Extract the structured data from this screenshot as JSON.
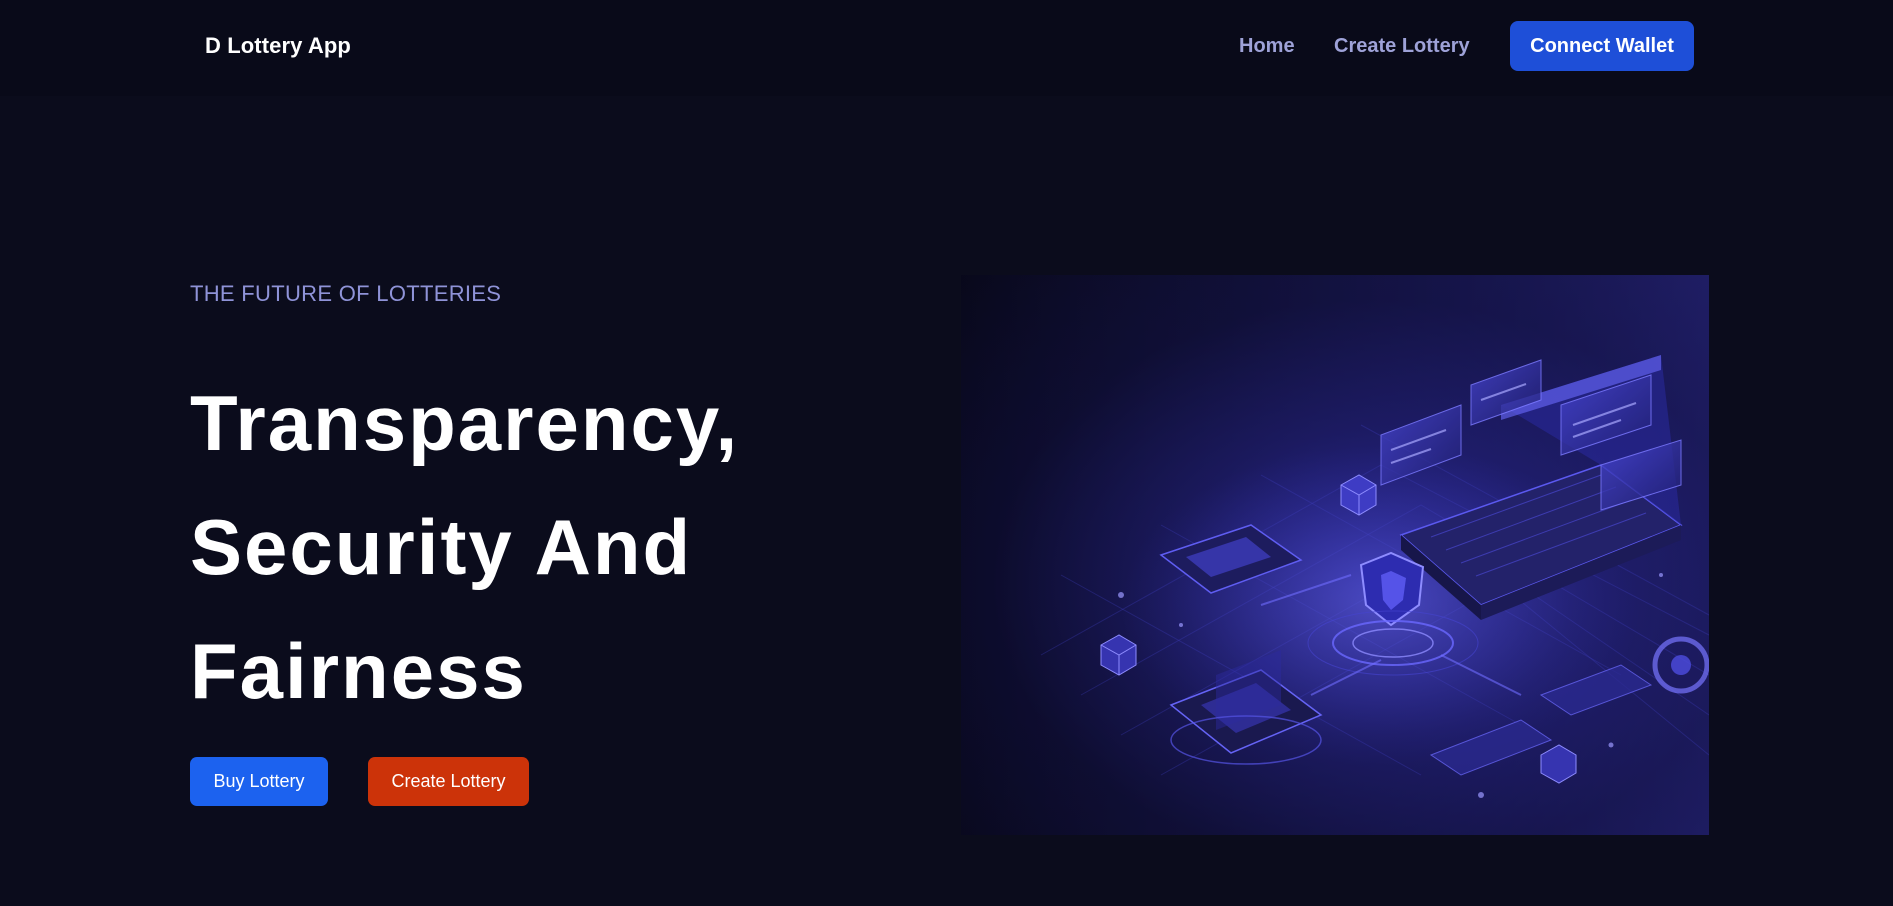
{
  "navbar": {
    "brand": "D Lottery App",
    "links": [
      {
        "label": "Home"
      },
      {
        "label": "Create Lottery"
      }
    ],
    "connect_wallet_label": "Connect Wallet"
  },
  "hero": {
    "eyebrow": "THE FUTURE OF LOTTERIES",
    "headline_lines": [
      "Transparency,",
      "Security And",
      "Fairness"
    ],
    "buy_button_label": "Buy Lottery",
    "create_button_label": "Create Lottery",
    "illustration_icon": "isometric-blockchain-security-illustration"
  },
  "colors": {
    "background": "#0b0c1c",
    "navbar": "#090a19",
    "connect_wallet": "#1e4fd8",
    "buy_button": "#1c62ef",
    "create_button": "#cc3309",
    "eyebrow_text": "#8f93d8",
    "nav_link": "#9ea2d8"
  }
}
